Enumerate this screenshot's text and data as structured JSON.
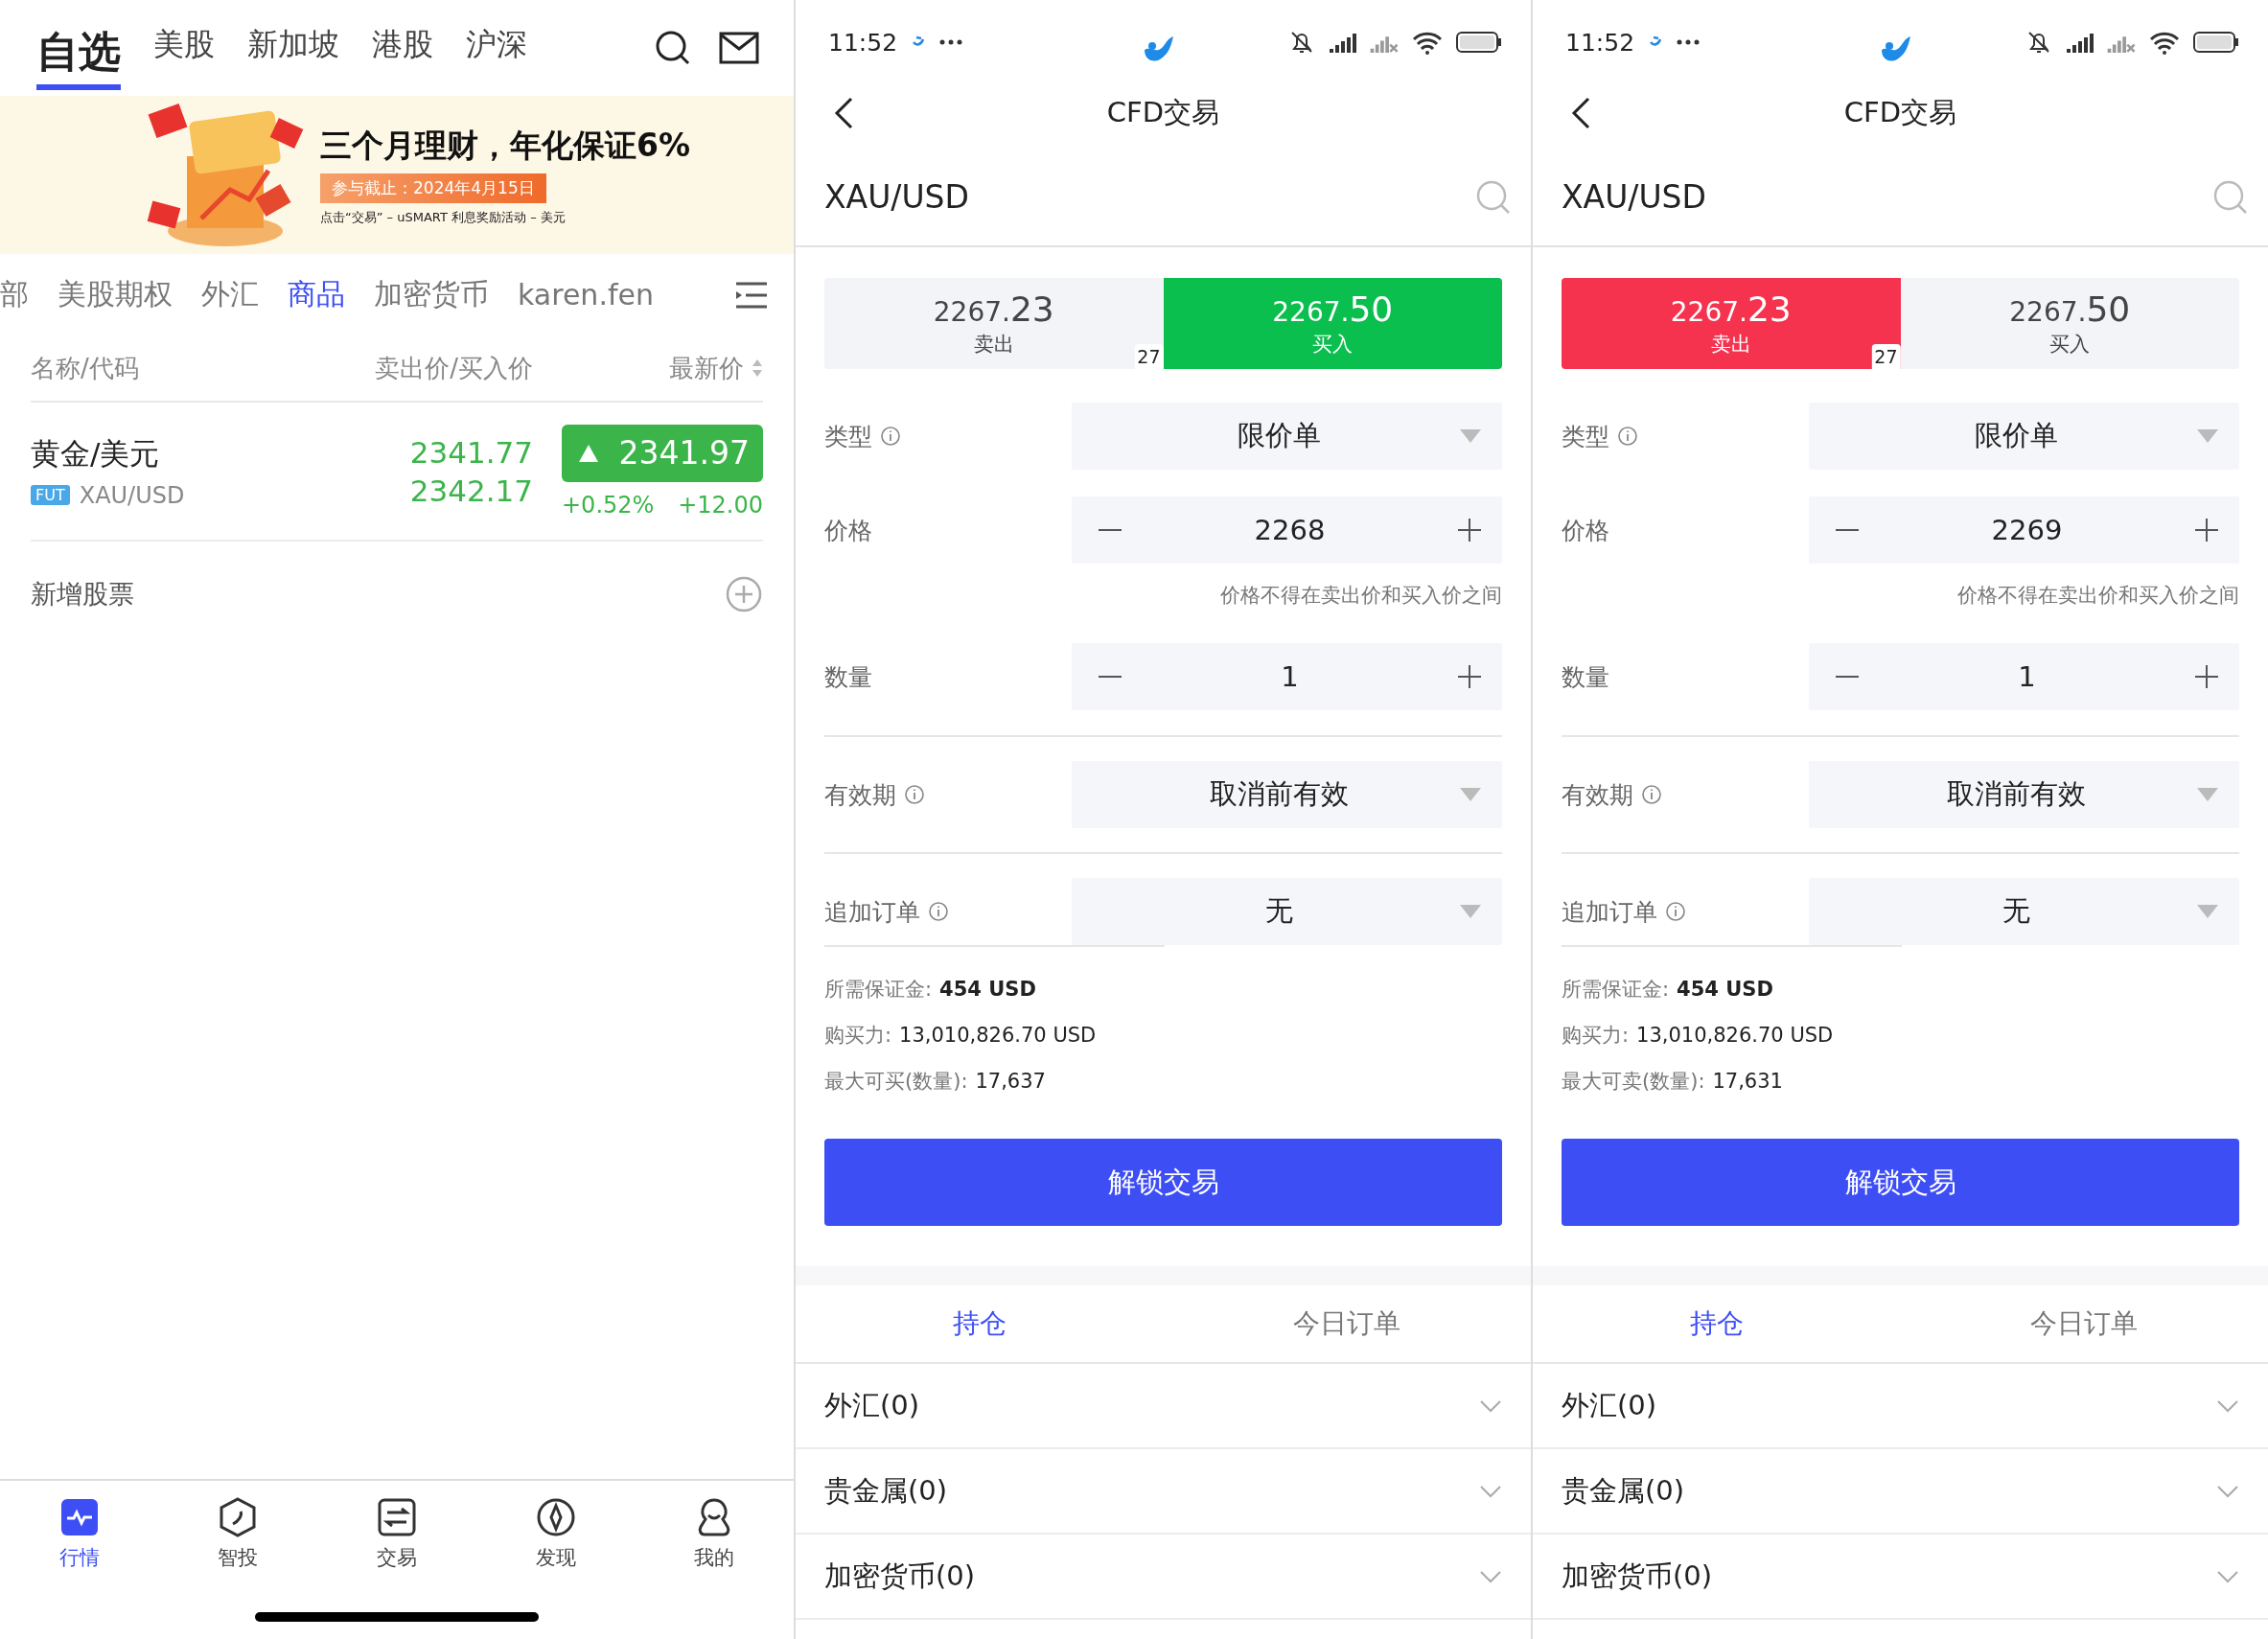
{
  "watchlist": {
    "top_tabs": [
      {
        "label": "自选",
        "selected": true
      },
      {
        "label": "美股",
        "selected": false
      },
      {
        "label": "新加坡",
        "selected": false
      },
      {
        "label": "港股",
        "selected": false
      },
      {
        "label": "沪深",
        "selected": false
      }
    ],
    "banner": {
      "kind": "picture",
      "title": "三个月理财，年化保证6%",
      "deadline": "参与截止：2024年4月15日",
      "note": "点击“交易” –  uSMART 利息奖励活动 – 美元"
    },
    "category_tabs": [
      {
        "label": "部",
        "selected": false
      },
      {
        "label": "美股期权",
        "selected": false
      },
      {
        "label": "外汇",
        "selected": false
      },
      {
        "label": "商品",
        "selected": true
      },
      {
        "label": "加密货币",
        "selected": false
      },
      {
        "label": "karen.fen",
        "selected": false
      }
    ],
    "columns": [
      "名称/代码",
      "卖出价/买入价",
      "最新价"
    ],
    "rows": [
      {
        "name": "黄金/美元",
        "badge": "FUT",
        "code": "XAU/USD",
        "sell": "2341.77",
        "buy": "2342.17",
        "latest": "2341.97",
        "change_pct": "+0.52%",
        "change": "+12.00",
        "rising": true
      }
    ],
    "add_label": "新增股票",
    "bottom_nav": [
      {
        "label": "行情",
        "selected": true
      },
      {
        "label": "智投",
        "selected": false
      },
      {
        "label": "交易",
        "selected": false
      },
      {
        "label": "发现",
        "selected": false
      },
      {
        "label": "我的",
        "selected": false
      }
    ]
  },
  "trade_screens": [
    {
      "time": "11:52",
      "title": "CFD交易",
      "symbol": "XAU/USD",
      "quote": {
        "sell": {
          "main": "2267.",
          "pips": "23",
          "label": "卖出",
          "selected": false
        },
        "buy": {
          "main": "2267.",
          "pips": "50",
          "label": "买入",
          "selected": true
        },
        "spread": "27"
      },
      "fields": [
        {
          "kind": "select",
          "label": "类型",
          "info": true,
          "value": "限价单"
        },
        {
          "kind": "stepper",
          "label": "价格",
          "info": false,
          "value": "2268",
          "hint": "价格不得在卖出价和买入价之间"
        },
        {
          "kind": "stepper",
          "label": "数量",
          "info": false,
          "value": "1"
        },
        {
          "kind": "select",
          "label": "有效期",
          "info": true,
          "value": "取消前有效"
        },
        {
          "kind": "select",
          "label": "追加订单",
          "info": true,
          "value": "无"
        }
      ],
      "summary": [
        {
          "label": "所需保证金:",
          "value": "454 USD",
          "emphasis": true
        },
        {
          "label": "购买力:",
          "value": "13,010,826.70 USD",
          "emphasis": false
        },
        {
          "label": "最大可买(数量):",
          "value": "17,637",
          "emphasis": false
        }
      ],
      "action": "解锁交易",
      "tabs": [
        {
          "label": "持仓",
          "selected": true
        },
        {
          "label": "今日订单",
          "selected": false
        }
      ],
      "groups": [
        "外汇(0)",
        "贵金属(0)",
        "加密货币(0)"
      ]
    },
    {
      "time": "11:52",
      "title": "CFD交易",
      "symbol": "XAU/USD",
      "quote": {
        "sell": {
          "main": "2267.",
          "pips": "23",
          "label": "卖出",
          "selected": true
        },
        "buy": {
          "main": "2267.",
          "pips": "50",
          "label": "买入",
          "selected": false
        },
        "spread": "27"
      },
      "fields": [
        {
          "kind": "select",
          "label": "类型",
          "info": true,
          "value": "限价单"
        },
        {
          "kind": "stepper",
          "label": "价格",
          "info": false,
          "value": "2269",
          "hint": "价格不得在卖出价和买入价之间"
        },
        {
          "kind": "stepper",
          "label": "数量",
          "info": false,
          "value": "1"
        },
        {
          "kind": "select",
          "label": "有效期",
          "info": true,
          "value": "取消前有效"
        },
        {
          "kind": "select",
          "label": "追加订单",
          "info": true,
          "value": "无"
        }
      ],
      "summary": [
        {
          "label": "所需保证金:",
          "value": "454 USD",
          "emphasis": true
        },
        {
          "label": "购买力:",
          "value": "13,010,826.70 USD",
          "emphasis": false
        },
        {
          "label": "最大可卖(数量):",
          "value": "17,631",
          "emphasis": false
        }
      ],
      "action": "解锁交易",
      "tabs": [
        {
          "label": "持仓",
          "selected": true
        },
        {
          "label": "今日订单",
          "selected": false
        }
      ],
      "groups": [
        "外汇(0)",
        "贵金属(0)",
        "加密货币(0)"
      ]
    }
  ]
}
